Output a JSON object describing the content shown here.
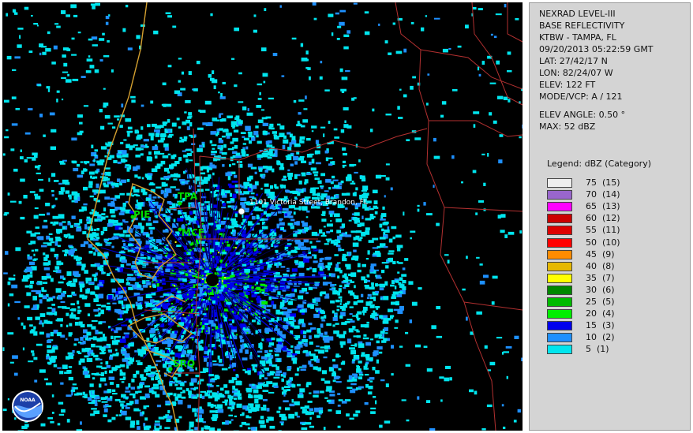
{
  "info": {
    "product": "NEXRAD LEVEL-III",
    "type": "BASE REFLECTIVITY",
    "station": "KTBW - TAMPA, FL",
    "datetime": "09/20/2013 05:22:59 GMT",
    "lat": "LAT: 27/42/17 N",
    "lon": "LON: 82/24/07 W",
    "elev": "ELEV: 122 FT",
    "mode": "MODE/VCP: A / 121",
    "elev_angle": "ELEV ANGLE: 0.50 °",
    "max": "MAX: 52 dBZ"
  },
  "legend": {
    "title": "Legend: dBZ (Category)",
    "items": [
      {
        "label": "75  (15)",
        "color": "#eeeeee"
      },
      {
        "label": "70  (14)",
        "color": "#9966cc"
      },
      {
        "label": "65  (13)",
        "color": "#ff00ff"
      },
      {
        "label": "60  (12)",
        "color": "#cc0000"
      },
      {
        "label": "55  (11)",
        "color": "#dd0000"
      },
      {
        "label": "50  (10)",
        "color": "#ff0000"
      },
      {
        "label": "45  (9)",
        "color": "#ff8c00"
      },
      {
        "label": "40  (8)",
        "color": "#e6b800"
      },
      {
        "label": "35  (7)",
        "color": "#ffff00"
      },
      {
        "label": "30  (6)",
        "color": "#008800"
      },
      {
        "label": "25  (5)",
        "color": "#00bb00"
      },
      {
        "label": "20  (4)",
        "color": "#00ee00"
      },
      {
        "label": "15  (3)",
        "color": "#0000ee"
      },
      {
        "label": "10  (2)",
        "color": "#1e90ff"
      },
      {
        "label": "5  (1)",
        "color": "#00e5ee"
      }
    ]
  },
  "map": {
    "stations": [
      "TPA",
      "PIE",
      "MCF",
      "SRQ"
    ],
    "address": "1101 Victoria Street, Brandon, FL",
    "logo_text": "NOAA",
    "colors": {
      "coast": "#d4a030",
      "county": "#b33030",
      "station": "#00dd00"
    }
  }
}
